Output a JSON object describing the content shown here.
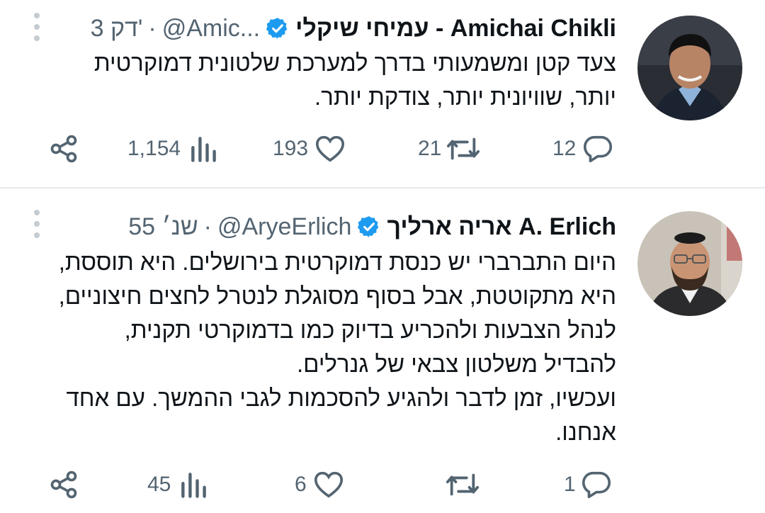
{
  "tweets": [
    {
      "author_name": "עמיחי שיקלי - Amichai Chikli",
      "handle": "@Amic...",
      "separator": "·",
      "time": "3 דק'",
      "body_lines": [
        "צעד קטן ומשמעותי בדרך למערכת שלטונית דמוקרטית",
        "יותר, שוויונית יותר, צודקת יותר."
      ],
      "stats": {
        "replies": "12",
        "retweets": "21",
        "likes": "193",
        "views": "1,154"
      }
    },
    {
      "author_name": "אריה ארליך A. Erlich",
      "handle": "@AryeErlich",
      "separator": "·",
      "time": "55 שנ׳",
      "body_lines": [
        "היום התברברי יש כנסת דמוקרטית בירושלים. היא תוססת,",
        "היא מתקוטטת, אבל בסוף מסוגלת לנטרל לחצים חיצוניים,",
        "לנהל הצבעות ולהכריע בדיוק כמו בדמוקרטי תקנית,",
        "להבדיל משלטון צבאי של גנרלים.",
        "ועכשיו, זמן לדבר ולהגיע להסכמות לגבי ההמשך. עם אחד",
        "אנחנו."
      ],
      "stats": {
        "replies": "1",
        "retweets": "",
        "likes": "6",
        "views": "45"
      }
    }
  ],
  "colors": {
    "verified": "#1d9bf0",
    "text": "#0f1419",
    "muted": "#536471",
    "divider": "#e6e9ec"
  },
  "icons": [
    "avatar-photo",
    "verified-badge-icon",
    "more-options-icon",
    "reply-icon",
    "retweet-icon",
    "like-icon",
    "views-icon",
    "share-icon"
  ]
}
